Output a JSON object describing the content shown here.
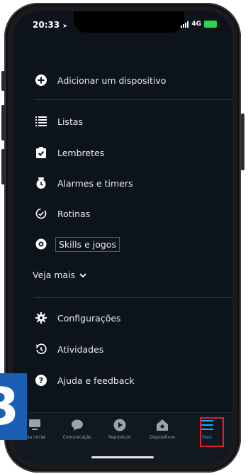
{
  "status_bar": {
    "time": "20:33",
    "network": "4G"
  },
  "menu": {
    "add_device": "Adicionar um dispositivo",
    "items": [
      {
        "label": "Listas",
        "icon": "list-icon"
      },
      {
        "label": "Lembretes",
        "icon": "reminder-icon"
      },
      {
        "label": "Alarmes e timers",
        "icon": "alarm-icon"
      },
      {
        "label": "Rotinas",
        "icon": "routines-icon"
      },
      {
        "label": "Skills e jogos",
        "icon": "skills-icon",
        "highlighted": true
      }
    ],
    "see_more": "Veja mais",
    "bottom_items": [
      {
        "label": "Configurações",
        "icon": "gear-icon"
      },
      {
        "label": "Atividades",
        "icon": "history-icon"
      },
      {
        "label": "Ajuda e feedback",
        "icon": "help-icon"
      }
    ]
  },
  "tabbar": {
    "tabs": [
      {
        "label": "Tela inicial",
        "icon": "home-icon"
      },
      {
        "label": "Comunicação",
        "icon": "chat-icon"
      },
      {
        "label": "Reproduzir",
        "icon": "play-icon"
      },
      {
        "label": "Dispositivos",
        "icon": "devices-icon"
      },
      {
        "label": "Mais",
        "icon": "menu-icon",
        "active": true
      }
    ]
  },
  "colors": {
    "background": "#0d131a",
    "accent": "#1ea7ff",
    "highlight_border": "#e0202a",
    "badge": "#1a5fb4"
  }
}
